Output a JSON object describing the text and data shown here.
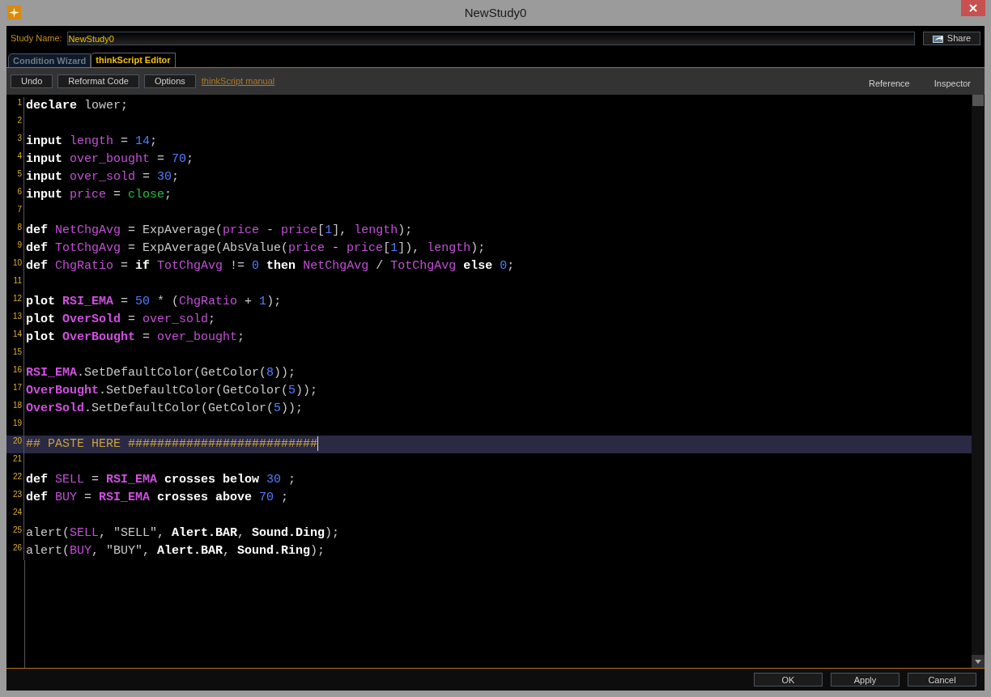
{
  "window": {
    "title": "NewStudy0"
  },
  "study_name": {
    "label": "Study Name:",
    "value": "NewStudy0"
  },
  "share_button": "Share",
  "tabs": [
    {
      "label": "Condition Wizard",
      "selected": false
    },
    {
      "label": "thinkScript Editor",
      "selected": true
    }
  ],
  "toolbar": {
    "buttons": [
      "Undo",
      "Reformat Code",
      "Options"
    ],
    "manual_link": "thinkScript manual",
    "side_links": [
      "Reference",
      "Inspector"
    ]
  },
  "editor": {
    "lines": [
      {
        "number": "1",
        "current": false,
        "tokens": [
          {
            "text": "declare",
            "kind": "keyword"
          },
          {
            "text": " lower;",
            "kind": "plain"
          }
        ]
      },
      {
        "number": "2",
        "current": false
      },
      {
        "number": "3",
        "current": false,
        "tokens": [
          {
            "text": "input ",
            "kind": "keyword"
          },
          {
            "text": "length",
            "kind": "variable"
          },
          {
            "text": " = ",
            "kind": "plain"
          },
          {
            "text": "14",
            "kind": "number"
          },
          {
            "text": ";",
            "kind": "plain"
          }
        ]
      },
      {
        "number": "4",
        "current": false,
        "tokens": [
          {
            "text": "input ",
            "kind": "keyword"
          },
          {
            "text": "over_bought",
            "kind": "variable"
          },
          {
            "text": " = ",
            "kind": "plain"
          },
          {
            "text": "70",
            "kind": "number"
          },
          {
            "text": ";",
            "kind": "plain"
          }
        ]
      },
      {
        "number": "5",
        "current": false,
        "tokens": [
          {
            "text": "input ",
            "kind": "keyword"
          },
          {
            "text": "over_sold",
            "kind": "variable"
          },
          {
            "text": " = ",
            "kind": "plain"
          },
          {
            "text": "30",
            "kind": "number"
          },
          {
            "text": ";",
            "kind": "plain"
          }
        ]
      },
      {
        "number": "6",
        "current": false,
        "tokens": [
          {
            "text": "input ",
            "kind": "keyword"
          },
          {
            "text": "price",
            "kind": "variable"
          },
          {
            "text": " = ",
            "kind": "plain"
          },
          {
            "text": "close",
            "kind": "constant"
          },
          {
            "text": ";",
            "kind": "plain"
          }
        ]
      },
      {
        "number": "7",
        "current": false
      },
      {
        "number": "8",
        "current": false,
        "tokens": [
          {
            "text": "def ",
            "kind": "keyword"
          },
          {
            "text": "NetChgAvg",
            "kind": "variable"
          },
          {
            "text": " = ExpAverage(",
            "kind": "plain"
          },
          {
            "text": "price",
            "kind": "variable"
          },
          {
            "text": " - ",
            "kind": "plain"
          },
          {
            "text": "price",
            "kind": "variable"
          },
          {
            "text": "[",
            "kind": "plain"
          },
          {
            "text": "1",
            "kind": "number"
          },
          {
            "text": "], ",
            "kind": "plain"
          },
          {
            "text": "length",
            "kind": "variable"
          },
          {
            "text": ");",
            "kind": "plain"
          }
        ]
      },
      {
        "number": "9",
        "current": false,
        "tokens": [
          {
            "text": "def ",
            "kind": "keyword"
          },
          {
            "text": "TotChgAvg",
            "kind": "variable"
          },
          {
            "text": " = ExpAverage(AbsValue(",
            "kind": "plain"
          },
          {
            "text": "price",
            "kind": "variable"
          },
          {
            "text": " - ",
            "kind": "plain"
          },
          {
            "text": "price",
            "kind": "variable"
          },
          {
            "text": "[",
            "kind": "plain"
          },
          {
            "text": "1",
            "kind": "number"
          },
          {
            "text": "]), ",
            "kind": "plain"
          },
          {
            "text": "length",
            "kind": "variable"
          },
          {
            "text": ");",
            "kind": "plain"
          }
        ]
      },
      {
        "number": "10",
        "current": false,
        "tokens": [
          {
            "text": "def ",
            "kind": "keyword"
          },
          {
            "text": "ChgRatio",
            "kind": "variable"
          },
          {
            "text": " = ",
            "kind": "plain"
          },
          {
            "text": "if ",
            "kind": "keyword"
          },
          {
            "text": "TotChgAvg",
            "kind": "variable"
          },
          {
            "text": " != ",
            "kind": "plain"
          },
          {
            "text": "0 ",
            "kind": "number"
          },
          {
            "text": "then ",
            "kind": "keyword"
          },
          {
            "text": "NetChgAvg",
            "kind": "variable"
          },
          {
            "text": " / ",
            "kind": "plain"
          },
          {
            "text": "TotChgAvg ",
            "kind": "variable"
          },
          {
            "text": "else ",
            "kind": "keyword"
          },
          {
            "text": "0",
            "kind": "number"
          },
          {
            "text": ";",
            "kind": "plain"
          }
        ]
      },
      {
        "number": "11",
        "current": false
      },
      {
        "number": "12",
        "current": false,
        "tokens": [
          {
            "text": "plot ",
            "kind": "keyword"
          },
          {
            "text": "RSI_EMA",
            "kind": "plot"
          },
          {
            "text": " = ",
            "kind": "plain"
          },
          {
            "text": "50",
            "kind": "number"
          },
          {
            "text": " * (",
            "kind": "plain"
          },
          {
            "text": "ChgRatio",
            "kind": "variable"
          },
          {
            "text": " + ",
            "kind": "plain"
          },
          {
            "text": "1",
            "kind": "number"
          },
          {
            "text": ");",
            "kind": "plain"
          }
        ]
      },
      {
        "number": "13",
        "current": false,
        "tokens": [
          {
            "text": "plot ",
            "kind": "keyword"
          },
          {
            "text": "OverSold",
            "kind": "plot"
          },
          {
            "text": " = ",
            "kind": "plain"
          },
          {
            "text": "over_sold",
            "kind": "variable"
          },
          {
            "text": ";",
            "kind": "plain"
          }
        ]
      },
      {
        "number": "14",
        "current": false,
        "tokens": [
          {
            "text": "plot ",
            "kind": "keyword"
          },
          {
            "text": "OverBought",
            "kind": "plot"
          },
          {
            "text": " = ",
            "kind": "plain"
          },
          {
            "text": "over_bought",
            "kind": "variable"
          },
          {
            "text": ";",
            "kind": "plain"
          }
        ]
      },
      {
        "number": "15",
        "current": false
      },
      {
        "number": "16",
        "current": false,
        "tokens": [
          {
            "text": "RSI_EMA",
            "kind": "plot"
          },
          {
            "text": ".SetDefaultColor(GetColor(",
            "kind": "plain"
          },
          {
            "text": "8",
            "kind": "number"
          },
          {
            "text": "));",
            "kind": "plain"
          }
        ]
      },
      {
        "number": "17",
        "current": false,
        "tokens": [
          {
            "text": "OverBought",
            "kind": "plot"
          },
          {
            "text": ".SetDefaultColor(GetColor(",
            "kind": "plain"
          },
          {
            "text": "5",
            "kind": "number"
          },
          {
            "text": "));",
            "kind": "plain"
          }
        ]
      },
      {
        "number": "18",
        "current": false,
        "tokens": [
          {
            "text": "OverSold",
            "kind": "plot"
          },
          {
            "text": ".SetDefaultColor(GetColor(",
            "kind": "plain"
          },
          {
            "text": "5",
            "kind": "number"
          },
          {
            "text": "));",
            "kind": "plain"
          }
        ]
      },
      {
        "number": "19",
        "current": false
      },
      {
        "number": "20",
        "current": true,
        "tokens": [
          {
            "text": "## PASTE HERE ##########################",
            "kind": "comment"
          }
        ]
      },
      {
        "number": "21",
        "current": false
      },
      {
        "number": "22",
        "current": false,
        "tokens": [
          {
            "text": "def ",
            "kind": "keyword"
          },
          {
            "text": "SELL",
            "kind": "variable"
          },
          {
            "text": " = ",
            "kind": "plain"
          },
          {
            "text": "RSI_EMA ",
            "kind": "plot"
          },
          {
            "text": "crosses below ",
            "kind": "keyword"
          },
          {
            "text": "30",
            "kind": "number"
          },
          {
            "text": " ;",
            "kind": "plain"
          }
        ]
      },
      {
        "number": "23",
        "current": false,
        "tokens": [
          {
            "text": "def ",
            "kind": "keyword"
          },
          {
            "text": "BUY",
            "kind": "variable"
          },
          {
            "text": " = ",
            "kind": "plain"
          },
          {
            "text": "RSI_EMA ",
            "kind": "plot"
          },
          {
            "text": "crosses above ",
            "kind": "keyword"
          },
          {
            "text": "70",
            "kind": "number"
          },
          {
            "text": " ;",
            "kind": "plain"
          }
        ]
      },
      {
        "number": "24",
        "current": false
      },
      {
        "number": "25",
        "current": false,
        "tokens": [
          {
            "text": "alert(",
            "kind": "plain"
          },
          {
            "text": "SELL",
            "kind": "variable"
          },
          {
            "text": ", \"SELL\", ",
            "kind": "plain"
          },
          {
            "text": "Alert.BAR",
            "kind": "keyword"
          },
          {
            "text": ", ",
            "kind": "plain"
          },
          {
            "text": "Sound.Ding",
            "kind": "keyword"
          },
          {
            "text": ");",
            "kind": "plain"
          }
        ]
      },
      {
        "number": "26",
        "current": false,
        "tokens": [
          {
            "text": "alert(",
            "kind": "plain"
          },
          {
            "text": "BUY",
            "kind": "variable"
          },
          {
            "text": ", \"BUY\", ",
            "kind": "plain"
          },
          {
            "text": "Alert.BAR",
            "kind": "keyword"
          },
          {
            "text": ", ",
            "kind": "plain"
          },
          {
            "text": "Sound.Ring",
            "kind": "keyword"
          },
          {
            "text": ");",
            "kind": "plain"
          }
        ]
      }
    ]
  },
  "footer_buttons": [
    "OK",
    "Apply",
    "Cancel"
  ]
}
